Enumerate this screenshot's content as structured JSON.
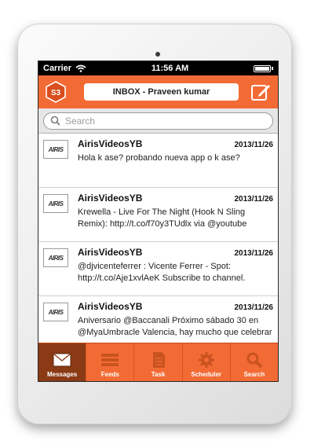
{
  "statusbar": {
    "carrier": "Carrier",
    "time": "11:56 AM"
  },
  "header": {
    "logo_text": "S3",
    "inbox_title": "INBOX - Praveen kumar"
  },
  "search": {
    "placeholder": "Search"
  },
  "messages": [
    {
      "avatar": "AIRIS",
      "sender": "AirisVideosYB",
      "date": "2013/11/26",
      "text": "Hola k ase? probando nueva app o k ase?"
    },
    {
      "avatar": "AIRIS",
      "sender": "AirisVideosYB",
      "date": "2013/11/26",
      "text": "Krewella - Live For The Night (Hook N Sling Remix): http://t.co/f70y3TUdlx via @youtube"
    },
    {
      "avatar": "AIRIS",
      "sender": "AirisVideosYB",
      "date": "2013/11/26",
      "text": "@djvicenteferrer : Vicente Ferrer - Spot: http://t.co/Aje1xvlAeK Subscribe to channel."
    },
    {
      "avatar": "AIRIS",
      "sender": "AirisVideosYB",
      "date": "2013/11/26",
      "text": "Aniversario @Baccanali  Próximo sábado 30 en @MyaUmbracle Valencia, hay mucho que celebrar"
    }
  ],
  "tabs": [
    {
      "label": "Messages",
      "icon": "envelope-icon",
      "active": true
    },
    {
      "label": "Feeds",
      "icon": "list-icon",
      "active": false
    },
    {
      "label": "Task",
      "icon": "document-icon",
      "active": false
    },
    {
      "label": "Scheduler",
      "icon": "gear-icon",
      "active": false
    },
    {
      "label": "Search",
      "icon": "magnifier-icon",
      "active": false
    }
  ],
  "colors": {
    "accent": "#f26b35",
    "active_tab": "#8a3a15",
    "statusbar": "#000000"
  }
}
